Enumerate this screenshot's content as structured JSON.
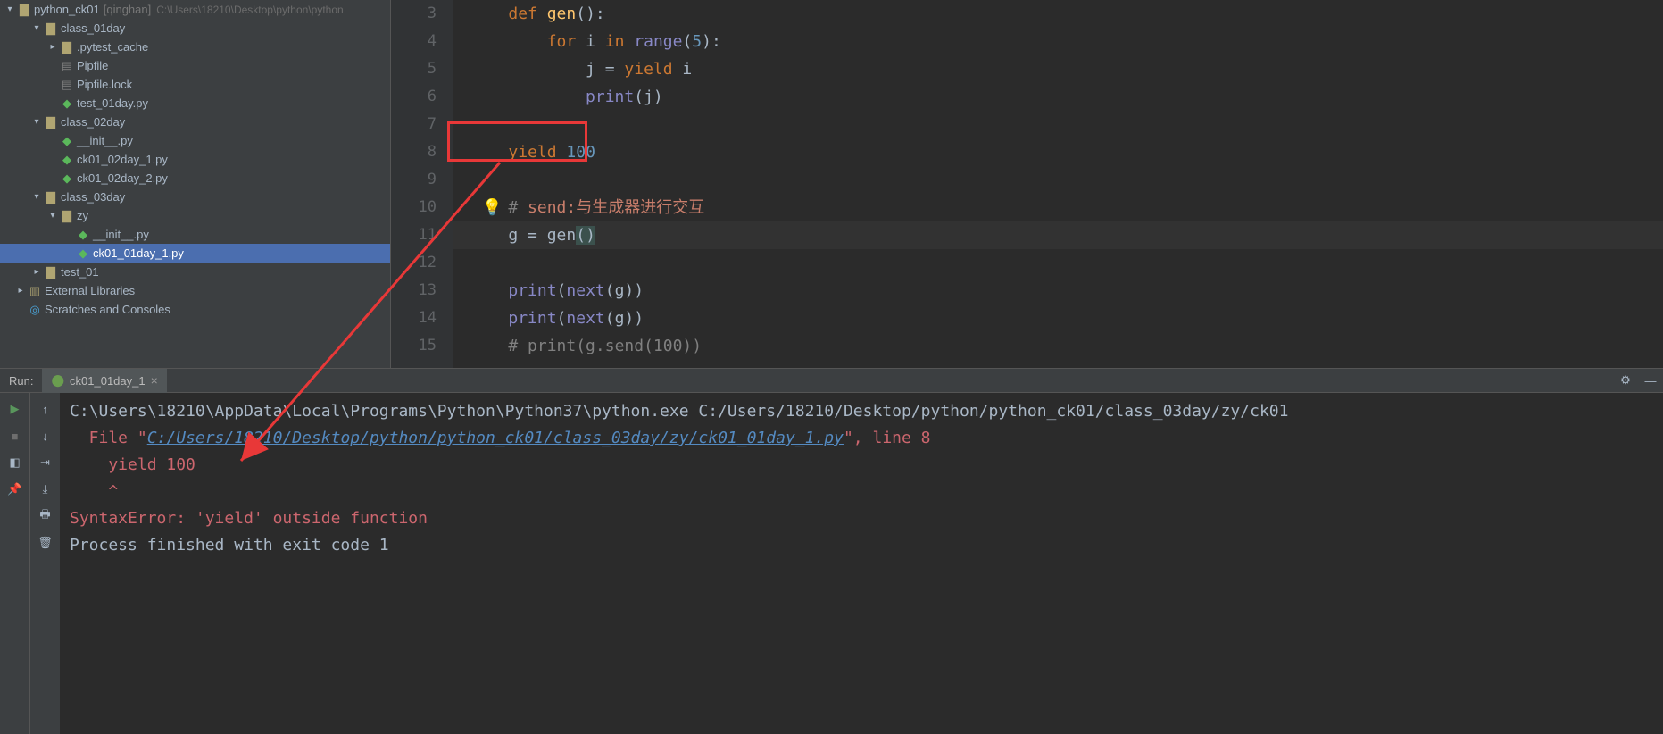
{
  "tree": {
    "root": {
      "name": "python_ck01",
      "qual": "[qinghan]",
      "path": "C:\\Users\\18210\\Desktop\\python\\python"
    },
    "items": [
      {
        "name": "class_01day",
        "type": "folder",
        "depth": 1,
        "expanded": true
      },
      {
        "name": ".pytest_cache",
        "type": "folder",
        "depth": 2,
        "expanded": false
      },
      {
        "name": "Pipfile",
        "type": "file",
        "depth": 2
      },
      {
        "name": "Pipfile.lock",
        "type": "file",
        "depth": 2
      },
      {
        "name": "test_01day.py",
        "type": "pyfile",
        "depth": 2
      },
      {
        "name": "class_02day",
        "type": "folder",
        "depth": 1,
        "expanded": true
      },
      {
        "name": "__init__.py",
        "type": "pyfile",
        "depth": 2
      },
      {
        "name": "ck01_02day_1.py",
        "type": "pyfile",
        "depth": 2
      },
      {
        "name": "ck01_02day_2.py",
        "type": "pyfile",
        "depth": 2
      },
      {
        "name": "class_03day",
        "type": "folder",
        "depth": 1,
        "expanded": true
      },
      {
        "name": "zy",
        "type": "folder",
        "depth": 2,
        "expanded": true
      },
      {
        "name": "__init__.py",
        "type": "pyfile",
        "depth": 3
      },
      {
        "name": "ck01_01day_1.py",
        "type": "pyfile",
        "depth": 3,
        "selected": true
      },
      {
        "name": "test_01",
        "type": "folder",
        "depth": 1,
        "expanded": false
      },
      {
        "name": "External Libraries",
        "type": "lib",
        "depth": 0,
        "expanded": false
      },
      {
        "name": "Scratches and Consoles",
        "type": "scratch",
        "depth": 0
      }
    ]
  },
  "editor": {
    "lines": [
      {
        "n": 3,
        "tokens": [
          {
            "t": "    ",
            "c": "plain"
          },
          {
            "t": "def ",
            "c": "kw"
          },
          {
            "t": "gen",
            "c": "fn"
          },
          {
            "t": "():",
            "c": "plain"
          }
        ]
      },
      {
        "n": 4,
        "tokens": [
          {
            "t": "        ",
            "c": "plain"
          },
          {
            "t": "for ",
            "c": "kw"
          },
          {
            "t": "i ",
            "c": "plain"
          },
          {
            "t": "in ",
            "c": "kw"
          },
          {
            "t": "range",
            "c": "builtin"
          },
          {
            "t": "(",
            "c": "plain"
          },
          {
            "t": "5",
            "c": "num"
          },
          {
            "t": "):",
            "c": "plain"
          }
        ]
      },
      {
        "n": 5,
        "tokens": [
          {
            "t": "            j = ",
            "c": "plain"
          },
          {
            "t": "yield ",
            "c": "kw"
          },
          {
            "t": "i",
            "c": "plain"
          }
        ]
      },
      {
        "n": 6,
        "tokens": [
          {
            "t": "            ",
            "c": "plain"
          },
          {
            "t": "print",
            "c": "builtin"
          },
          {
            "t": "(j)",
            "c": "plain"
          }
        ]
      },
      {
        "n": 7,
        "tokens": []
      },
      {
        "n": 8,
        "tokens": [
          {
            "t": "    ",
            "c": "plain"
          },
          {
            "t": "yield ",
            "c": "kw"
          },
          {
            "t": "100",
            "c": "num"
          }
        ]
      },
      {
        "n": 9,
        "tokens": []
      },
      {
        "n": 10,
        "tokens": [
          {
            "t": "    ",
            "c": "plain"
          },
          {
            "t": "# ",
            "c": "cmt"
          },
          {
            "t": "send:与生成器进行交互",
            "c": "cmt-cn"
          }
        ],
        "bulb": true
      },
      {
        "n": 11,
        "hl": true,
        "tokens": [
          {
            "t": "    g = gen",
            "c": "plain"
          },
          {
            "t": "(",
            "c": "paren-hl"
          },
          {
            "t": ")",
            "c": "paren-hl"
          }
        ]
      },
      {
        "n": 12,
        "tokens": []
      },
      {
        "n": 13,
        "tokens": [
          {
            "t": "    ",
            "c": "plain"
          },
          {
            "t": "print",
            "c": "builtin"
          },
          {
            "t": "(",
            "c": "plain"
          },
          {
            "t": "next",
            "c": "builtin"
          },
          {
            "t": "(g))",
            "c": "plain"
          }
        ]
      },
      {
        "n": 14,
        "tokens": [
          {
            "t": "    ",
            "c": "plain"
          },
          {
            "t": "print",
            "c": "builtin"
          },
          {
            "t": "(",
            "c": "plain"
          },
          {
            "t": "next",
            "c": "builtin"
          },
          {
            "t": "(g))",
            "c": "plain"
          }
        ]
      },
      {
        "n": 15,
        "tokens": [
          {
            "t": "    ",
            "c": "plain"
          },
          {
            "t": "# print(g.send(100))",
            "c": "cmt"
          }
        ]
      }
    ]
  },
  "run": {
    "label": "Run:",
    "tab_name": "ck01_01day_1",
    "console": [
      {
        "c": "c-def",
        "t": "C:\\Users\\18210\\AppData\\Local\\Programs\\Python\\Python37\\python.exe C:/Users/18210/Desktop/python/python_ck01/class_03day/zy/ck01"
      },
      {
        "spans": [
          {
            "c": "c-err",
            "t": "  File \""
          },
          {
            "c": "c-link",
            "t": "C:/Users/18210/Desktop/python/python_ck01/class_03day/zy/ck01_01day_1.py"
          },
          {
            "c": "c-err",
            "t": "\", line 8"
          }
        ]
      },
      {
        "c": "c-err",
        "t": "    yield 100"
      },
      {
        "c": "c-err",
        "t": "    ^"
      },
      {
        "c": "c-err",
        "t": "SyntaxError: 'yield' outside function"
      },
      {
        "c": "c-def",
        "t": ""
      },
      {
        "c": "c-def",
        "t": "Process finished with exit code 1"
      }
    ]
  }
}
